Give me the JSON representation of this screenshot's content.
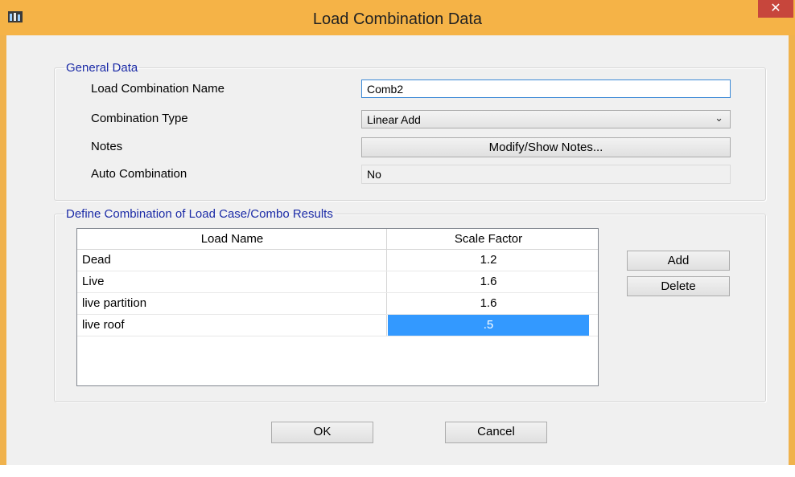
{
  "window": {
    "title": "Load Combination Data",
    "close_glyph": "✕",
    "app_icon": "app-icon"
  },
  "general": {
    "legend": "General Data",
    "name_label": "Load Combination Name",
    "name_value": "Comb2",
    "type_label": "Combination Type",
    "type_value": "Linear Add",
    "notes_label": "Notes",
    "notes_button": "Modify/Show Notes...",
    "auto_label": "Auto Combination",
    "auto_value": "No"
  },
  "combination": {
    "legend": "Define Combination of Load Case/Combo Results",
    "columns": [
      "Load Name",
      "Scale Factor"
    ],
    "rows": [
      {
        "name": "Dead",
        "factor": "1.2"
      },
      {
        "name": "Live",
        "factor": "1.6"
      },
      {
        "name": "live partition",
        "factor": "1.6"
      },
      {
        "name": "live roof",
        "factor": ".5",
        "selected": true
      }
    ],
    "add_button": "Add",
    "delete_button": "Delete"
  },
  "footer": {
    "ok": "OK",
    "cancel": "Cancel"
  },
  "colors": {
    "titlebar": "#f5b347",
    "close": "#c7463c",
    "legend_text": "#1a2aa6",
    "selection": "#3399ff"
  }
}
